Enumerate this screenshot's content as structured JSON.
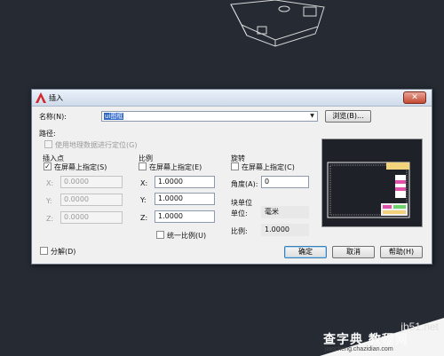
{
  "dialog": {
    "title": "插入",
    "close_glyph": "✕",
    "name_label": "名称(N):",
    "name_value": "ui图框",
    "browse_label": "浏览(B)...",
    "path_label": "路径:",
    "geo_label": "使用地理数据进行定位(G)",
    "insertion": {
      "title": "插入点",
      "on_screen_label": "在屏幕上指定(S)",
      "on_screen_checked": true,
      "x_label": "X:",
      "x_value": "0.0000",
      "y_label": "Y:",
      "y_value": "0.0000",
      "z_label": "Z:",
      "z_value": "0.0000"
    },
    "scale": {
      "title": "比例",
      "on_screen_label": "在屏幕上指定(E)",
      "on_screen_checked": false,
      "x_label": "X:",
      "x_value": "1.0000",
      "y_label": "Y:",
      "y_value": "1.0000",
      "z_label": "Z:",
      "z_value": "1.0000",
      "uniform_label": "统一比例(U)",
      "uniform_checked": false
    },
    "rotation": {
      "title": "旋转",
      "on_screen_label": "在屏幕上指定(C)",
      "on_screen_checked": false,
      "angle_label": "角度(A):",
      "angle_value": "0"
    },
    "block_unit": {
      "title": "块单位",
      "unit_label": "单位:",
      "unit_value": "毫米",
      "factor_label": "比例:",
      "factor_value": "1.0000"
    },
    "explode_label": "分解(D)",
    "ok_label": "确定",
    "cancel_label": "取消",
    "help_label": "帮助(H)"
  },
  "watermark": {
    "site": "jb51.net",
    "main": "查字典 教程网",
    "url": "jiaocheng.chazidian.com"
  },
  "colors": {
    "desktop_bg": "#252a33",
    "dialog_bg": "#f0f0f0",
    "selection": "#3068c8",
    "preview_bg": "#1e2128"
  }
}
